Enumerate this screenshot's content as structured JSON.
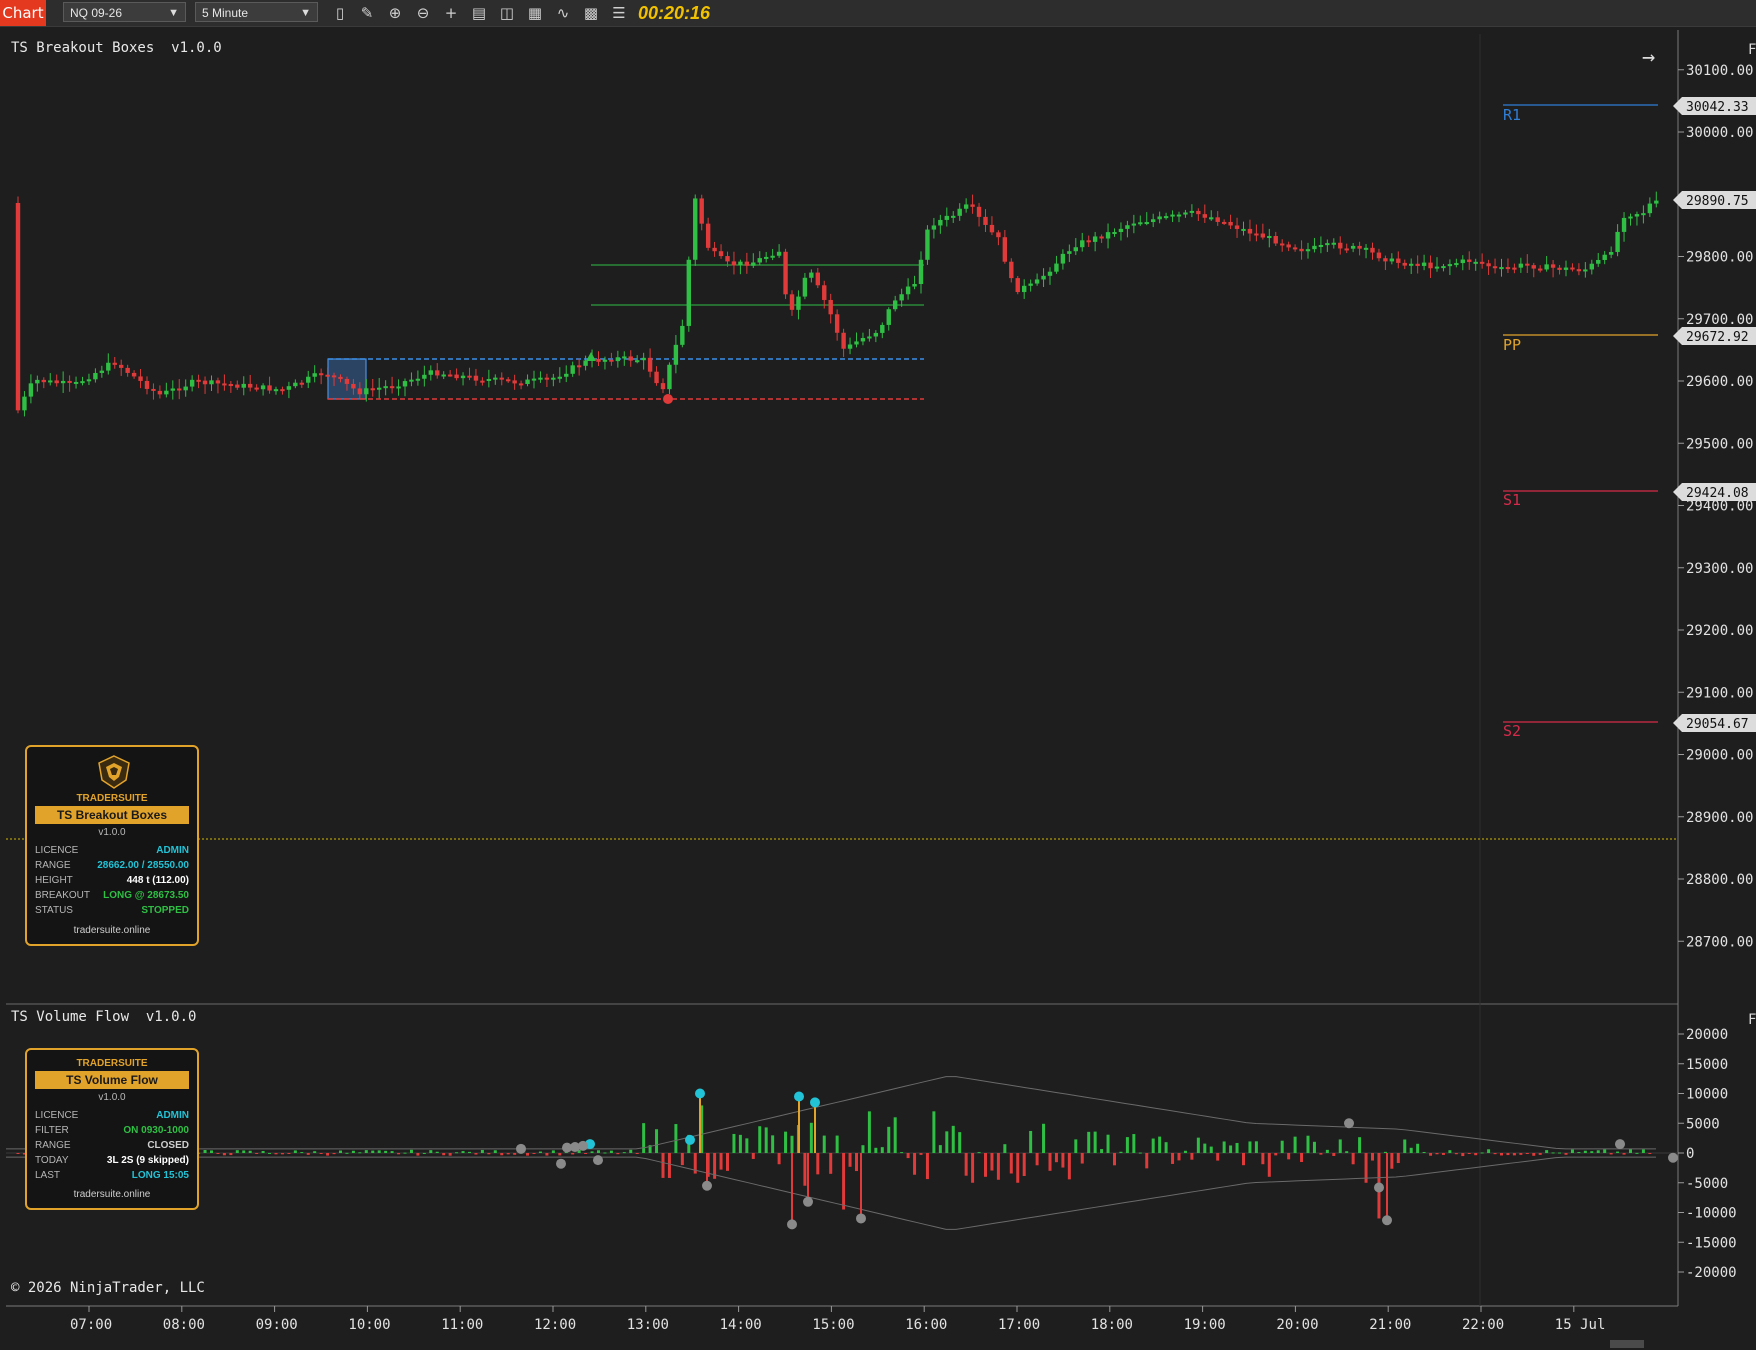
{
  "toolbar": {
    "tab_label": "Chart",
    "instrument": "NQ 09-26",
    "timeframe": "5 Minute",
    "timer": "00:20:16",
    "icons": [
      "bar-type-icon",
      "draw-pencil-icon",
      "zoom-in-icon",
      "zoom-out-icon",
      "crosshair-icon",
      "data-box-icon",
      "properties-icon",
      "strategies-icon",
      "indicators-icon",
      "templates-icon",
      "chart-trader-icon"
    ]
  },
  "colors": {
    "up": "#2fbf45",
    "down": "#e03a3a",
    "accent": "#e2a32b",
    "r1": "#2f7fd6",
    "pp": "#e2a32b",
    "s": "#d62b4a",
    "cyan": "#22c3d6"
  },
  "price_panel": {
    "title": "TS Breakout Boxes  v1.0.0",
    "levels": [
      {
        "name": "R1",
        "value": "30042.33"
      },
      {
        "name": "PP",
        "value": "29672.92"
      },
      {
        "name": "S1",
        "value": "29424.08"
      },
      {
        "name": "S2",
        "value": "29054.67"
      }
    ],
    "last_price": "29890.75",
    "axis_ticks": [
      "30100.00",
      "30000.00",
      "29800.00",
      "29700.00",
      "29600.00",
      "29500.00",
      "29400.00",
      "29300.00",
      "29200.00",
      "29100.00",
      "29000.00",
      "28900.00",
      "28800.00",
      "28700.00"
    ]
  },
  "volume_panel": {
    "title": "TS Volume Flow  v1.0.0",
    "axis_ticks": [
      "20000",
      "15000",
      "10000",
      "5000",
      "0",
      "-5000",
      "-10000",
      "-15000",
      "-20000"
    ]
  },
  "time_axis": [
    "07:00",
    "08:00",
    "09:00",
    "10:00",
    "11:00",
    "12:00",
    "13:00",
    "14:00",
    "15:00",
    "16:00",
    "17:00",
    "18:00",
    "19:00",
    "20:00",
    "21:00",
    "22:00",
    "15 Jul"
  ],
  "copyright": "© 2026 NinjaTrader, LLC",
  "breakout_box": {
    "brand": "TRADERSUITE",
    "name": "TS Breakout Boxes",
    "version": "v1.0.0",
    "rows": [
      {
        "k": "LICENCE",
        "v": "ADMIN",
        "color": "#22c3d6"
      },
      {
        "k": "RANGE",
        "v": "28662.00 / 28550.00",
        "color": "#22c3d6"
      },
      {
        "k": "HEIGHT",
        "v": "448 t  (112.00)",
        "color": "#ffffff"
      },
      {
        "k": "BREAKOUT",
        "v": "LONG @ 28673.50",
        "color": "#2fbf45"
      },
      {
        "k": "STATUS",
        "v": "STOPPED",
        "color": "#2fbf45"
      }
    ],
    "site": "tradersuite.online"
  },
  "volume_box": {
    "brand": "TRADERSUITE",
    "name": "TS Volume Flow",
    "version": "v1.0.0",
    "rows": [
      {
        "k": "LICENCE",
        "v": "ADMIN",
        "color": "#22c3d6"
      },
      {
        "k": "FILTER",
        "v": "ON  0930-1000",
        "color": "#2fbf45"
      },
      {
        "k": "RANGE",
        "v": "CLOSED",
        "color": "#cfcfcf"
      },
      {
        "k": "TODAY",
        "v": "3L  2S  (9 skipped)",
        "color": "#ffffff"
      },
      {
        "k": "LAST",
        "v": "LONG 15:05",
        "color": "#22c3d6"
      }
    ],
    "site": "tradersuite.online"
  }
}
